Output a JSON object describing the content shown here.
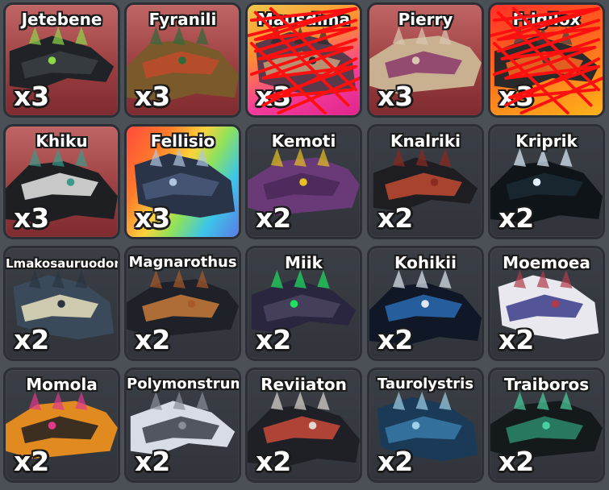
{
  "items": [
    {
      "name": "Jetebene",
      "qty": "x3",
      "bg": "red",
      "colors": [
        "#1f2226",
        "#3a3f44",
        "#8fd64a"
      ],
      "scribbled": false
    },
    {
      "name": "Fyranili",
      "qty": "x3",
      "bg": "red",
      "colors": [
        "#7a5a2a",
        "#c04a2a",
        "#2e6a3a"
      ],
      "scribbled": false
    },
    {
      "name": "Mausdima",
      "qty": "x3",
      "bg": "pink",
      "colors": [
        "#5a3a4a",
        "#c9a17a",
        "#2a2a2a"
      ],
      "scribbled": true
    },
    {
      "name": "Pierry",
      "qty": "x3",
      "bg": "red",
      "colors": [
        "#c9b090",
        "#8a3a6a",
        "#d8c8b0"
      ],
      "scribbled": false
    },
    {
      "name": "Frigilox",
      "qty": "x3",
      "bg": "fire",
      "colors": [
        "#2a2a2a",
        "#ff6a1e",
        "#3a3f44"
      ],
      "scribbled": true
    },
    {
      "name": "Khiku",
      "qty": "x3",
      "bg": "red",
      "colors": [
        "#1e1f23",
        "#e6e6e6",
        "#3a9a8a"
      ],
      "scribbled": false
    },
    {
      "name": "Fellisio",
      "qty": "x3",
      "bg": "rainbow",
      "colors": [
        "#2a3448",
        "#4a5a7a",
        "#b0c4e0"
      ],
      "scribbled": false
    },
    {
      "name": "Kemoti",
      "qty": "x2",
      "bg": "gray",
      "colors": [
        "#6a3a78",
        "#4a2858",
        "#e8c020"
      ],
      "scribbled": false
    },
    {
      "name": "Knalriki",
      "qty": "x2",
      "bg": "gray",
      "colors": [
        "#1e1e22",
        "#c04a30",
        "#8a2a20"
      ],
      "scribbled": false
    },
    {
      "name": "Kriprik",
      "qty": "x2",
      "bg": "gray",
      "colors": [
        "#0e1418",
        "#1a2a34",
        "#e0f0ff"
      ],
      "scribbled": false
    },
    {
      "name": "Lmakosauruodon",
      "qty": "x2",
      "bg": "gray",
      "colors": [
        "#3a4a5a",
        "#e8e0c0",
        "#2a3440"
      ],
      "scribbled": false
    },
    {
      "name": "Magnarothus",
      "qty": "x2",
      "bg": "gray",
      "colors": [
        "#1e2228",
        "#c87a3a",
        "#a85a2a"
      ],
      "scribbled": false
    },
    {
      "name": "Miik",
      "qty": "x2",
      "bg": "gray",
      "colors": [
        "#2a2640",
        "#4a4460",
        "#20e060"
      ],
      "scribbled": false
    },
    {
      "name": "Kohikii",
      "qty": "x2",
      "bg": "gray",
      "colors": [
        "#101828",
        "#2a6ab0",
        "#e0e8f0"
      ],
      "scribbled": false
    },
    {
      "name": "Moemoea",
      "qty": "x2",
      "bg": "gray",
      "colors": [
        "#e8e8ee",
        "#3a3a8a",
        "#b03a4a"
      ],
      "scribbled": false
    },
    {
      "name": "Momola",
      "qty": "x2",
      "bg": "gray",
      "colors": [
        "#e08a20",
        "#1e1e22",
        "#e03a8a"
      ],
      "scribbled": false
    },
    {
      "name": "Polymonstrum",
      "qty": "x2",
      "bg": "gray",
      "colors": [
        "#d8dce4",
        "#3a3e48",
        "#8a8e98"
      ],
      "scribbled": false
    },
    {
      "name": "Reviiaton",
      "qty": "x2",
      "bg": "gray",
      "colors": [
        "#1e2026",
        "#c84a3a",
        "#e0d8d0"
      ],
      "scribbled": false
    },
    {
      "name": "Taurolystris",
      "qty": "x2",
      "bg": "gray",
      "colors": [
        "#1a3a58",
        "#3a7aa8",
        "#a0d0e8"
      ],
      "scribbled": false
    },
    {
      "name": "Traiboros",
      "qty": "x2",
      "bg": "gray",
      "colors": [
        "#141a1c",
        "#2a8a6a",
        "#4ad0a0"
      ],
      "scribbled": false
    }
  ]
}
